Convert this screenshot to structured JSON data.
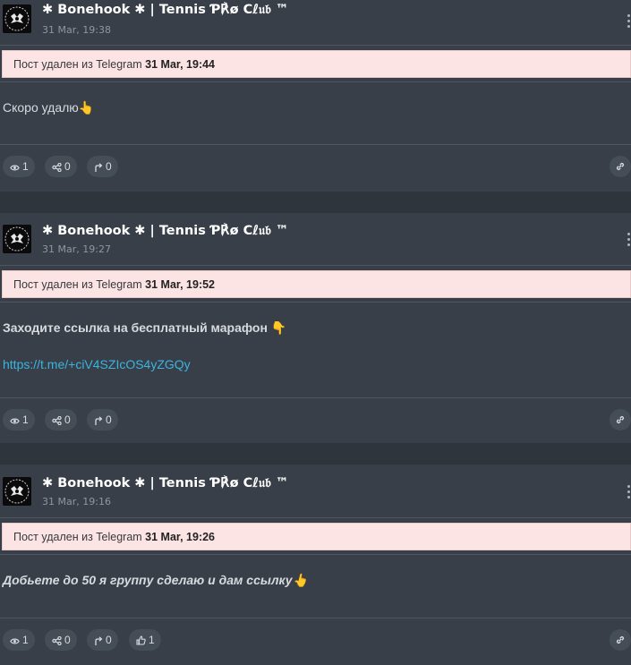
{
  "posts": [
    {
      "channel": "✱ Bonehook ✱ | Tennis Ƥ℟ø Cℓ𝔲𝔟 ™",
      "date": "31 Mar, 19:38",
      "notice_prefix": "Пост удален из Telegram",
      "notice_date": "31 Mar, 19:44",
      "text": "Скоро удалю",
      "text_emoji": "👆",
      "link": "",
      "views": "1",
      "shares": "0",
      "forwards": "0",
      "likes": ""
    },
    {
      "channel": "✱ Bonehook ✱ | Tennis Ƥ℟ø Cℓ𝔲𝔟 ™",
      "date": "31 Mar, 19:27",
      "notice_prefix": "Пост удален из Telegram",
      "notice_date": "31 Mar, 19:52",
      "text": "Заходите ссылка на бесплатный марафон",
      "text_emoji": "👇",
      "link": "https://t.me/+ciV4SZIcOS4yZGQy",
      "views": "1",
      "shares": "0",
      "forwards": "0",
      "likes": ""
    },
    {
      "channel": "✱ Bonehook ✱ | Tennis Ƥ℟ø Cℓ𝔲𝔟 ™",
      "date": "31 Mar, 19:16",
      "notice_prefix": "Пост удален из Telegram",
      "notice_date": "31 Mar, 19:26",
      "text": "Добьете до 50 я группу сделаю и дам ссылку",
      "text_emoji": "👆",
      "link": "",
      "views": "1",
      "shares": "0",
      "forwards": "0",
      "likes": "1"
    }
  ],
  "icons": {
    "views": "eye-icon",
    "shares": "share-icon",
    "forwards": "forward-arrow-icon",
    "likes": "thumbs-up-icon",
    "permalink": "link-icon",
    "menu": "more-vertical-icon"
  },
  "colors": {
    "background": "#383f48",
    "notice_background": "#fde4e4",
    "link": "#3bb4e0",
    "pill": "#454d57"
  }
}
